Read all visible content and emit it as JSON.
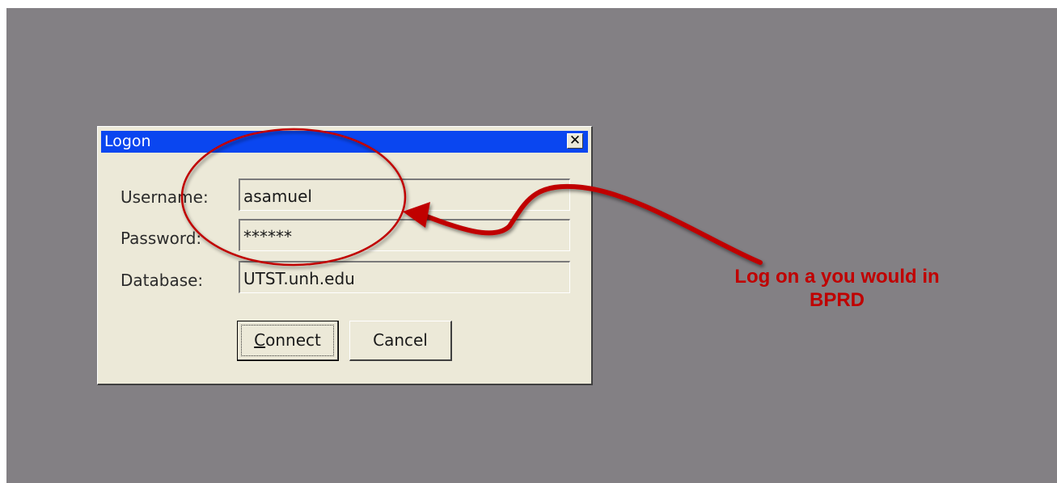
{
  "dialog": {
    "title": "Logon",
    "close_icon": "close-icon",
    "fields": {
      "username": {
        "label": "Username:",
        "value": "asamuel"
      },
      "password": {
        "label": "Password:",
        "value": "******"
      },
      "database": {
        "label": "Database:",
        "value": "UTST.unh.edu"
      }
    },
    "buttons": {
      "connect_mnemonic": "C",
      "connect_rest": "onnect",
      "cancel": "Cancel"
    }
  },
  "annotation": {
    "line1": "Log on a you would in",
    "line2": "BPRD",
    "color": "#c00000"
  },
  "colors": {
    "titlebar": "#0a46f0",
    "dialog_bg": "#ece9d8",
    "backdrop": "#838084"
  }
}
